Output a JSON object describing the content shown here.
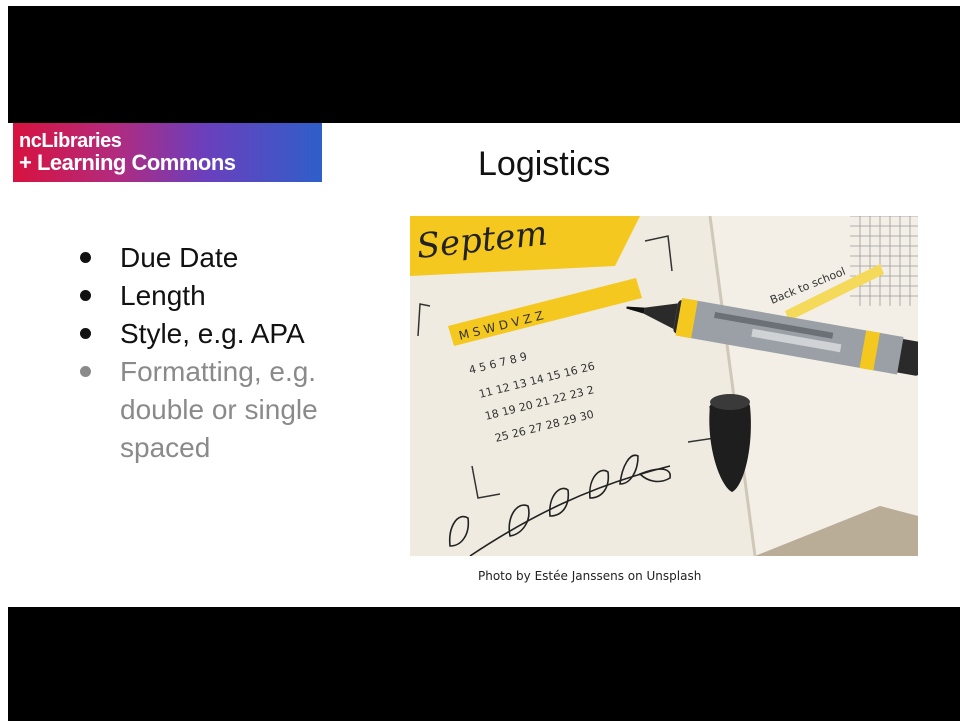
{
  "logo": {
    "line1": "ncLibraries",
    "line2": "+ Learning Commons"
  },
  "slide": {
    "title": "Logistics",
    "bullets": [
      "Due Date",
      "Length",
      "Style, e.g. APA",
      "Formatting, e.g. double or single spaced"
    ],
    "photo_credit": "Photo by Estée Janssens on Unsplash"
  },
  "photo": {
    "month_label": "Septem",
    "weekdays": "M S W D V Z Z",
    "dates": [
      "4 5 6 7 8 9",
      "11 12 13 14 15 16 26",
      "18 19 20 21 22 23 2",
      "25 26 27 28 29 30"
    ],
    "note": "Back to school"
  },
  "colors": {
    "accent_yellow": "#f4c81e",
    "paper": "#efebe0",
    "muted_text": "#8a8a8a"
  }
}
